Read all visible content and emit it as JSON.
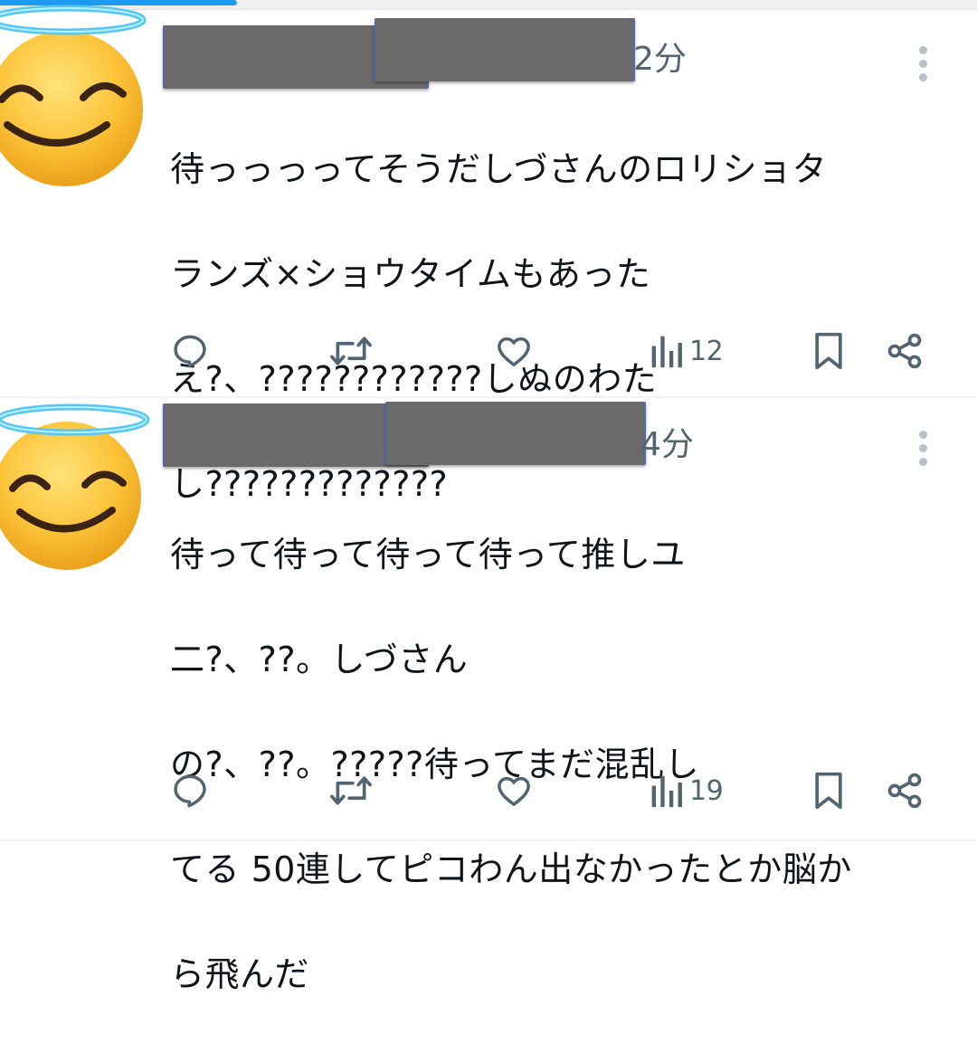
{
  "tweets": [
    {
      "avatar": "smiling-face-with-halo-emoji",
      "time": "2分",
      "lines": [
        "待っっっってそうだしづさんのロリショタ",
        "ランズ×ショウタイムもあった",
        "え?、????????????しぬのわた",
        "し?????????????"
      ],
      "views": "12"
    },
    {
      "avatar": "smiling-face-with-halo-emoji",
      "time": "4分",
      "lines": [
        "待って待って待って待って推しユ",
        "二?、??。しづさん",
        "の?、??。?????待ってまだ混乱し",
        "てる 50連してピコわん出なかったとか脳か",
        "ら飛んだ"
      ],
      "views": "19"
    }
  ],
  "icons": {
    "reply": "reply-icon",
    "retweet": "retweet-icon",
    "like": "like-icon",
    "views": "views-icon",
    "bookmark": "bookmark-icon",
    "share": "share-icon",
    "more": "more-icon"
  },
  "colors": {
    "accent": "#1d9bf0",
    "icon": "#536471",
    "text": "#0f1419",
    "redaction": "#6a6a6a"
  }
}
